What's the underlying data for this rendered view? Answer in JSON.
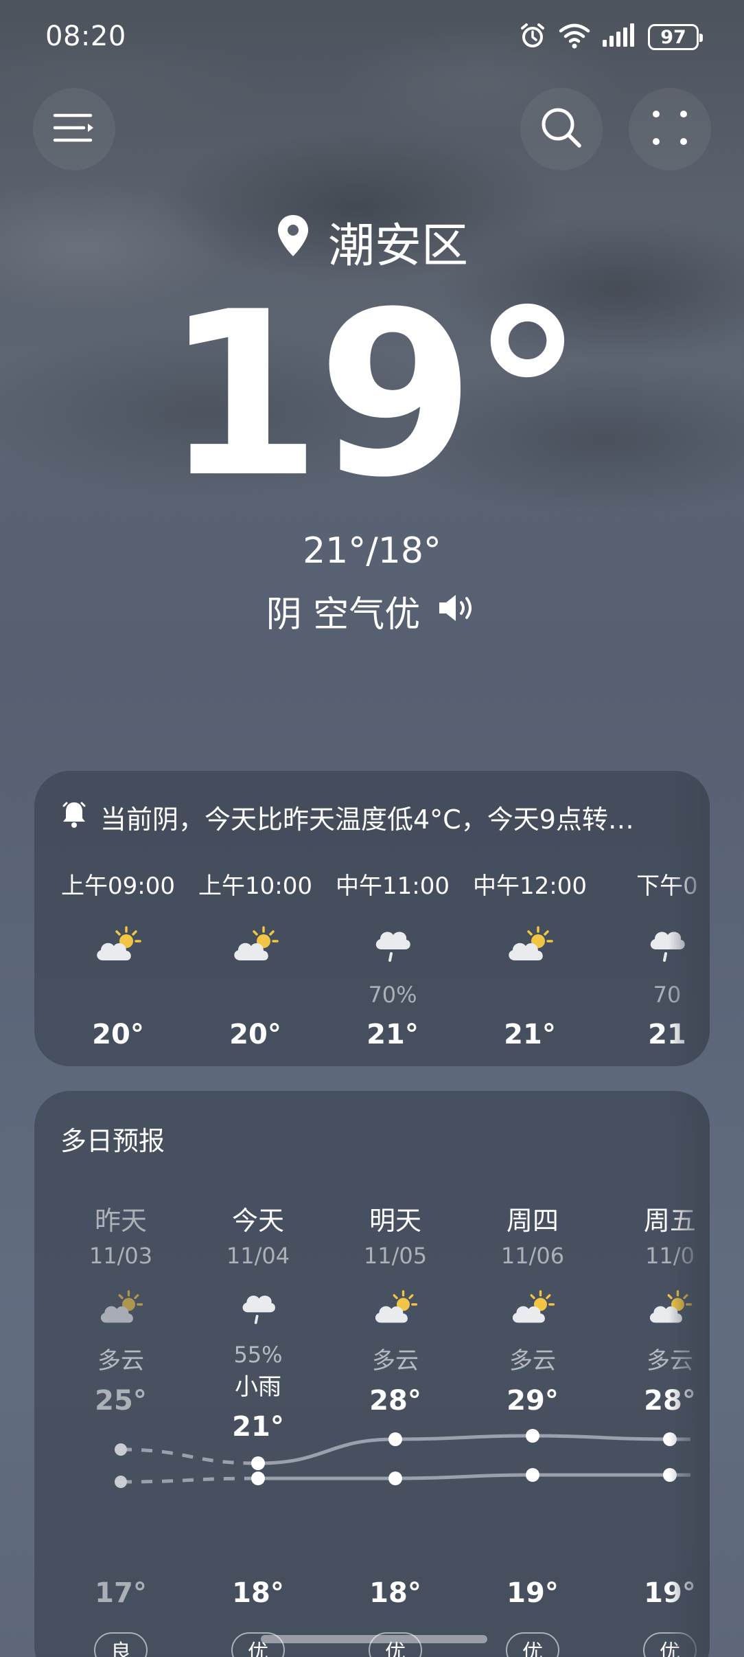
{
  "status_bar": {
    "time": "08:20",
    "battery": "97"
  },
  "location": {
    "name": "潮安区"
  },
  "current": {
    "temperature": "19°",
    "hi_lo": "21°/18°",
    "condition_line": "阴 空气优"
  },
  "hourly": {
    "alert_text": "当前阴，今天比昨天温度低4°C，今天9点转…",
    "items": [
      {
        "time": "上午09:00",
        "icon": "partly-cloudy-icon",
        "pop": "",
        "temp": "20°"
      },
      {
        "time": "上午10:00",
        "icon": "partly-cloudy-icon",
        "pop": "",
        "temp": "20°"
      },
      {
        "time": "中午11:00",
        "icon": "light-rain-icon",
        "pop": "70%",
        "temp": "21°"
      },
      {
        "time": "中午12:00",
        "icon": "partly-cloudy-icon",
        "pop": "",
        "temp": "21°"
      },
      {
        "time": "下午0",
        "icon": "light-rain-icon",
        "pop": "70",
        "temp": "21"
      }
    ]
  },
  "daily": {
    "title": "多日预报",
    "days": [
      {
        "name": "昨天",
        "date": "11/03",
        "icon": "partly-cloudy-icon",
        "pop": "",
        "condition": "多云",
        "high": "25°",
        "low": "17°",
        "aqi": "良",
        "high_value": 25,
        "low_value": 17
      },
      {
        "name": "今天",
        "date": "11/04",
        "icon": "light-rain-icon",
        "pop": "55%",
        "condition": "小雨",
        "high": "21°",
        "low": "18°",
        "aqi": "优",
        "high_value": 21,
        "low_value": 18
      },
      {
        "name": "明天",
        "date": "11/05",
        "icon": "partly-cloudy-icon",
        "pop": "",
        "condition": "多云",
        "high": "28°",
        "low": "18°",
        "aqi": "优",
        "high_value": 28,
        "low_value": 18
      },
      {
        "name": "周四",
        "date": "11/06",
        "icon": "partly-cloudy-icon",
        "pop": "",
        "condition": "多云",
        "high": "29°",
        "low": "19°",
        "aqi": "优",
        "high_value": 29,
        "low_value": 19
      },
      {
        "name": "周五",
        "date": "11/0",
        "icon": "partly-cloudy-icon",
        "pop": "",
        "condition": "多云",
        "high": "28°",
        "low": "19°",
        "aqi": "优",
        "high_value": 28,
        "low_value": 19
      }
    ]
  },
  "colors": {
    "sun": "#f2c544",
    "cloud": "#e9ebee",
    "line": "#9aa1ad"
  }
}
